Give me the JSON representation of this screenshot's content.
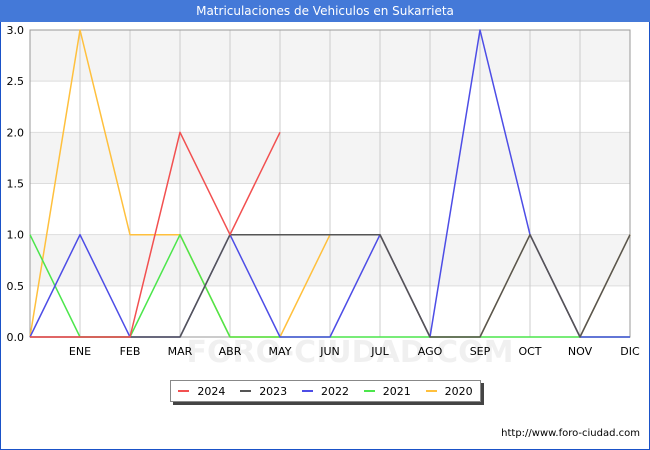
{
  "header": {
    "title": "Matriculaciones de Vehiculos en Sukarrieta"
  },
  "footer": {
    "url": "http://www.foro-ciudad.com"
  },
  "watermark": "FORO-CIUDAD.COM",
  "chart_data": {
    "type": "line",
    "title": "Matriculaciones de Vehiculos en Sukarrieta",
    "xlabel": "",
    "ylabel": "",
    "categories": [
      "",
      "ENE",
      "FEB",
      "MAR",
      "ABR",
      "MAY",
      "JUN",
      "JUL",
      "AGO",
      "SEP",
      "OCT",
      "NOV",
      "DIC"
    ],
    "ylim": [
      0,
      3
    ],
    "yticks": [
      "0.0",
      "0.5",
      "1.0",
      "1.5",
      "2.0",
      "2.5",
      "3.0"
    ],
    "grid": true,
    "legend_position": "bottom",
    "series": [
      {
        "name": "2024",
        "color": "#f25050",
        "values": [
          0,
          0,
          0,
          2,
          1,
          2,
          null,
          null,
          null,
          null,
          null,
          null,
          null
        ]
      },
      {
        "name": "2023",
        "color": "#555555",
        "values": [
          0,
          0,
          0,
          0,
          1,
          1,
          1,
          1,
          0,
          0,
          1,
          0,
          1
        ]
      },
      {
        "name": "2022",
        "color": "#4d4de6",
        "values": [
          0,
          1,
          0,
          0,
          1,
          0,
          0,
          1,
          0,
          3,
          1,
          0,
          0
        ]
      },
      {
        "name": "2021",
        "color": "#4ce64c",
        "values": [
          1,
          0,
          0,
          1,
          0,
          0,
          0,
          0,
          0,
          0,
          0,
          0,
          0
        ]
      },
      {
        "name": "2020",
        "color": "#ffc03d",
        "values": [
          0,
          3,
          1,
          1,
          0,
          0,
          1,
          1,
          0,
          0,
          1,
          0,
          1
        ]
      }
    ]
  }
}
